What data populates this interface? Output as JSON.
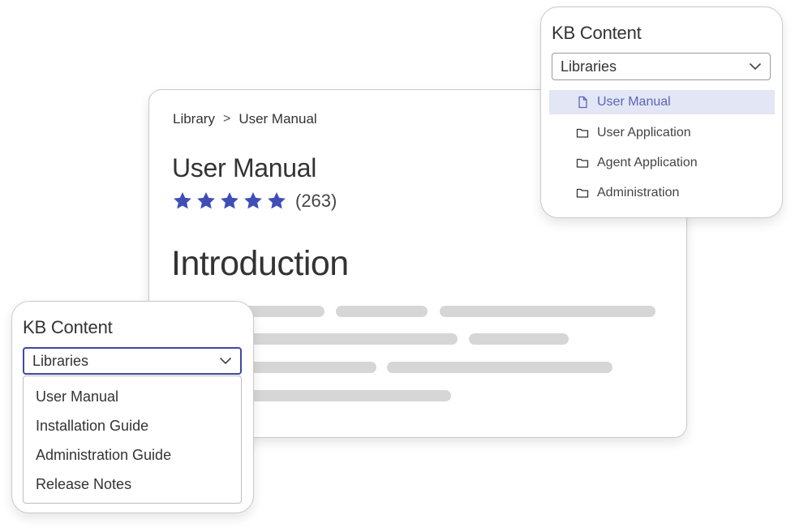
{
  "article": {
    "breadcrumb": [
      "Library",
      "User Manual"
    ],
    "breadcrumb_separator": ">",
    "title": "User Manual",
    "rating": {
      "stars": 5,
      "max": 5,
      "count": "(263)",
      "star_color": "#3f4eb6"
    },
    "heading": "Introduction",
    "placeholder_color": "#d6d6d6"
  },
  "kb_top": {
    "title": "KB Content",
    "select_value": "Libraries",
    "items": [
      {
        "label": "User Manual",
        "icon": "document-icon",
        "active": true
      },
      {
        "label": "User Application",
        "icon": "folder-icon",
        "active": false
      },
      {
        "label": "Agent Application",
        "icon": "folder-icon",
        "active": false
      },
      {
        "label": "Administration",
        "icon": "folder-icon",
        "active": false
      }
    ],
    "active_bg": "#e3e6f4",
    "active_color": "#5a66b8"
  },
  "kb_bottom": {
    "title": "KB Content",
    "select_value": "Libraries",
    "focus_border_color": "#3f4a9e",
    "options": [
      "User Manual",
      "Installation Guide",
      "Administration Guide",
      "Release Notes"
    ]
  }
}
